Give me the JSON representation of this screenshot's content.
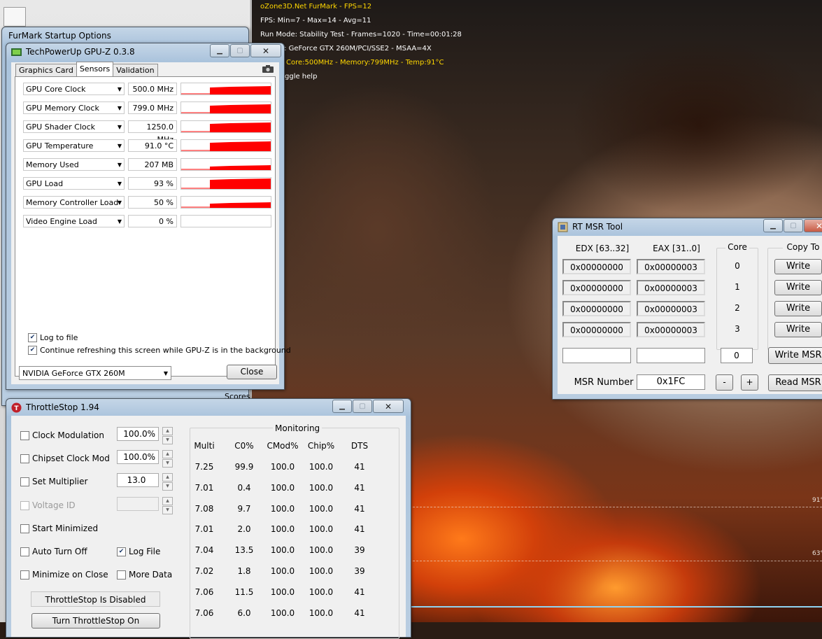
{
  "osd": {
    "line1": "oZone3D.Net FurMark - FPS=12",
    "line2": "FPS: Min=7 - Max=14 - Avg=11",
    "line3": "Run Mode: Stability Test - Frames=1020 - Time=00:01:28",
    "line4": "er: GeForce GTX 260M/PCI/SSE2 - MSAA=4X",
    "line5": "Core:500MHz - Memory:799MHz - Temp:91°C",
    "line6": "ggle help"
  },
  "scene": {
    "mark1": "91°",
    "mark2": "63°"
  },
  "furmark": {
    "title": "FurMark Startup Options",
    "scores": "Scores"
  },
  "gpuz": {
    "title": "TechPowerUp GPU-Z 0.3.8",
    "tabs": [
      "Graphics Card",
      "Sensors",
      "Validation"
    ],
    "sensors": [
      {
        "name": "GPU Core Clock",
        "value": "500.0 MHz",
        "graph_level": 0.75
      },
      {
        "name": "GPU Memory Clock",
        "value": "799.0 MHz",
        "graph_level": 0.8
      },
      {
        "name": "GPU Shader Clock",
        "value": "1250.0 MHz",
        "graph_level": 0.85
      },
      {
        "name": "GPU Temperature",
        "value": "91.0 °C",
        "graph_level": 0.9
      },
      {
        "name": "Memory Used",
        "value": "207 MB",
        "graph_level": 0.45
      },
      {
        "name": "GPU Load",
        "value": "93 %",
        "graph_level": 0.93
      },
      {
        "name": "Memory Controller Load",
        "value": "50 %",
        "graph_level": 0.5
      },
      {
        "name": "Video Engine Load",
        "value": "0 %",
        "graph_level": 0
      }
    ],
    "log_to_file": "Log to file",
    "continue_refresh": "Continue refreshing this screen while GPU-Z is in the background",
    "gpu_select": "NVIDIA GeForce GTX 260M",
    "close": "Close",
    "graph_color": "#ff0000"
  },
  "throttlestop": {
    "title": "ThrottleStop 1.94",
    "clock_modulation": "Clock Modulation",
    "clock_modulation_value": "100.0%",
    "chipset_clock_mod": "Chipset Clock Mod",
    "chipset_clock_mod_value": "100.0%",
    "set_multiplier": "Set Multiplier",
    "set_multiplier_value": "13.0",
    "voltage_id": "Voltage ID",
    "start_minimized": "Start Minimized",
    "auto_turn_off": "Auto Turn Off",
    "log_file": "Log File",
    "minimize_on_close": "Minimize on Close",
    "more_data": "More Data",
    "status": "ThrottleStop Is Disabled",
    "turn_on": "Turn ThrottleStop On",
    "monitoring": "Monitoring",
    "headers": [
      "Multi",
      "C0%",
      "CMod%",
      "Chip%",
      "DTS"
    ],
    "rows": [
      [
        "7.25",
        "99.9",
        "100.0",
        "100.0",
        "41"
      ],
      [
        "7.01",
        "0.4",
        "100.0",
        "100.0",
        "41"
      ],
      [
        "7.08",
        "9.7",
        "100.0",
        "100.0",
        "41"
      ],
      [
        "7.01",
        "2.0",
        "100.0",
        "100.0",
        "41"
      ],
      [
        "7.04",
        "13.5",
        "100.0",
        "100.0",
        "39"
      ],
      [
        "7.02",
        "1.8",
        "100.0",
        "100.0",
        "39"
      ],
      [
        "7.06",
        "11.5",
        "100.0",
        "100.0",
        "41"
      ],
      [
        "7.06",
        "6.0",
        "100.0",
        "100.0",
        "41"
      ]
    ]
  },
  "msr": {
    "title": "RT MSR Tool",
    "edx_label": "EDX [63..32]",
    "eax_label": "EAX  [31..0]",
    "core_label": "Core",
    "copy_to_label": "Copy To",
    "rows": [
      {
        "edx": "0x00000000",
        "eax": "0x00000003",
        "core": "0",
        "button": "Write"
      },
      {
        "edx": "0x00000000",
        "eax": "0x00000003",
        "core": "1",
        "button": "Write"
      },
      {
        "edx": "0x00000000",
        "eax": "0x00000003",
        "core": "2",
        "button": "Write"
      },
      {
        "edx": "0x00000000",
        "eax": "0x00000003",
        "core": "3",
        "button": "Write"
      }
    ],
    "edx_input": "",
    "eax_input": "",
    "core_input": "0",
    "write_msr": "Write MSR",
    "msr_number_label": "MSR Number",
    "msr_number": "0x1FC",
    "minus": "-",
    "plus": "+",
    "read_msr": "Read MSR"
  }
}
